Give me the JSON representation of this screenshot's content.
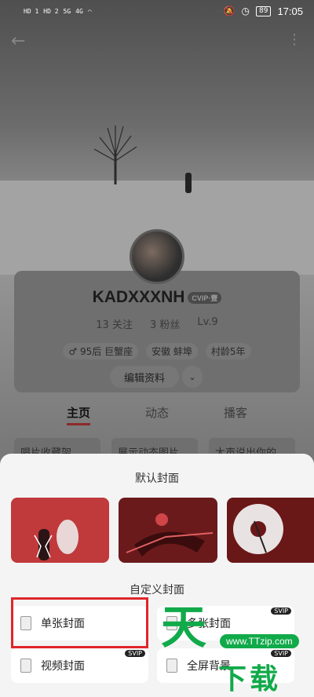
{
  "status_bar": {
    "left": [
      "HD 1",
      "HD 2",
      "5G",
      "4G"
    ],
    "battery": "89",
    "time": "17:05"
  },
  "profile": {
    "username": "KADXXXNH",
    "vip_badge": "CVIP·壹",
    "stats": [
      "13 关注",
      "3 粉丝",
      "Lv.9"
    ],
    "tags": [
      "♂ 95后 巨蟹座",
      "安徽 蚌埠",
      "村龄5年"
    ],
    "edit_label": "编辑资料",
    "tabs": [
      "主页",
      "动态",
      "播客"
    ],
    "items": [
      "唱片收藏架",
      "展示动态图片",
      "大声说出你的"
    ]
  },
  "sheet": {
    "default_title": "默认封面",
    "custom_title": "自定义封面",
    "options": [
      {
        "label": "单张封面",
        "svip": ""
      },
      {
        "label": "多张封面",
        "svip": "SVIP"
      },
      {
        "label": "视频封面",
        "svip": "SVIP"
      },
      {
        "label": "全屏背景",
        "svip": "SVIP"
      }
    ]
  },
  "watermark": {
    "big": "天",
    "url": "www.TTzip.com",
    "rest": "下载"
  },
  "colors": {
    "accent_red": "#e0262b",
    "cover_red": "#c0393b",
    "watermark_green": "#11aa4a"
  }
}
